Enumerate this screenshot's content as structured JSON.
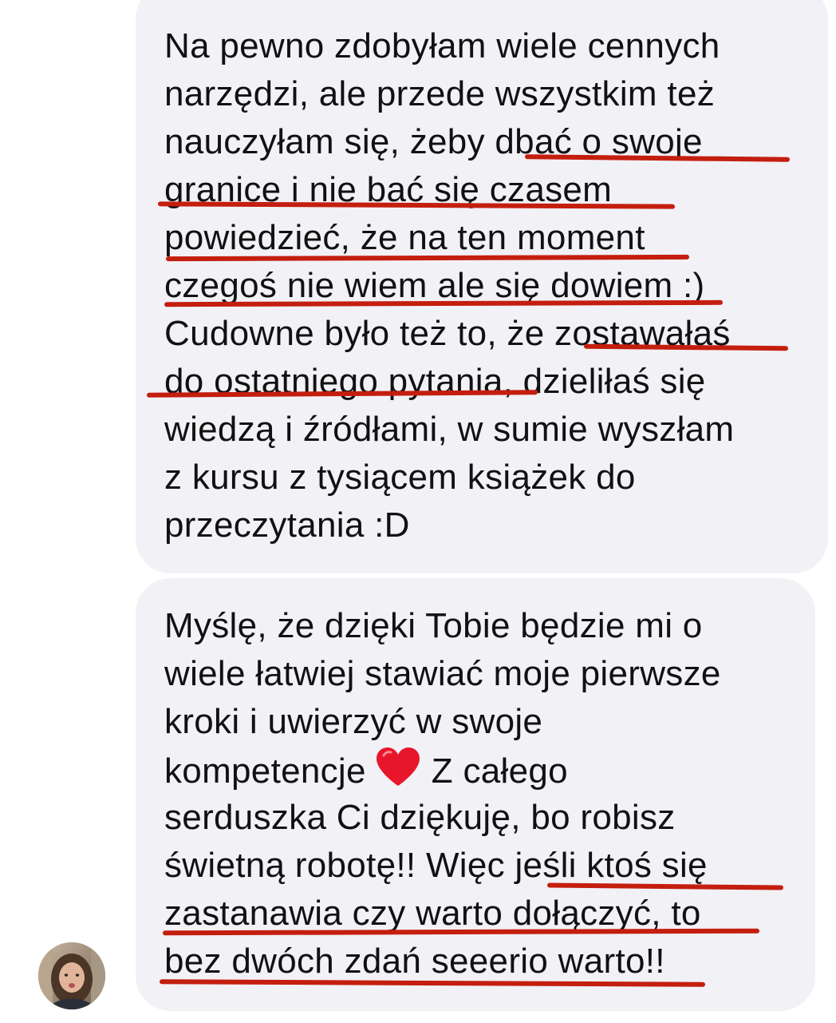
{
  "messages": [
    {
      "lines": [
        "Na pewno zdobyłam wiele cennych",
        "narzędzi, ale przede wszystkim też",
        "nauczyłam się, żeby dbać o swoje",
        "granice i nie bać się czasem",
        "powiedzieć, że na ten moment",
        "czegoś nie wiem ale się dowiem :)",
        "Cudowne było też to, że zostawałaś",
        "do ostatniego pytania, dzieliłaś się",
        "wiedzą i źródłami, w sumie wyszłam",
        "z kursu z tysiącem książek do",
        "przeczytania :D"
      ]
    },
    {
      "lines": [
        "Myślę, że dzięki Tobie będzie mi o",
        "wiele łatwiej stawiać moje pierwsze",
        "kroki i uwierzyć w swoje",
        "kompetencje",
        "Z całego",
        "serduszka Ci dziękuję, bo robisz",
        "świetną robotę!! Więc jeśli ktoś się",
        "zastanawia czy warto dołączyć, to",
        "bez dwóch zdań seeerio warto!!"
      ]
    }
  ],
  "colors": {
    "bubble": "#f1f1f6",
    "text": "#111111",
    "underline": "#c41e0f"
  },
  "icons": {
    "emoji": "red-heart-icon",
    "avatar": "sender-avatar"
  }
}
